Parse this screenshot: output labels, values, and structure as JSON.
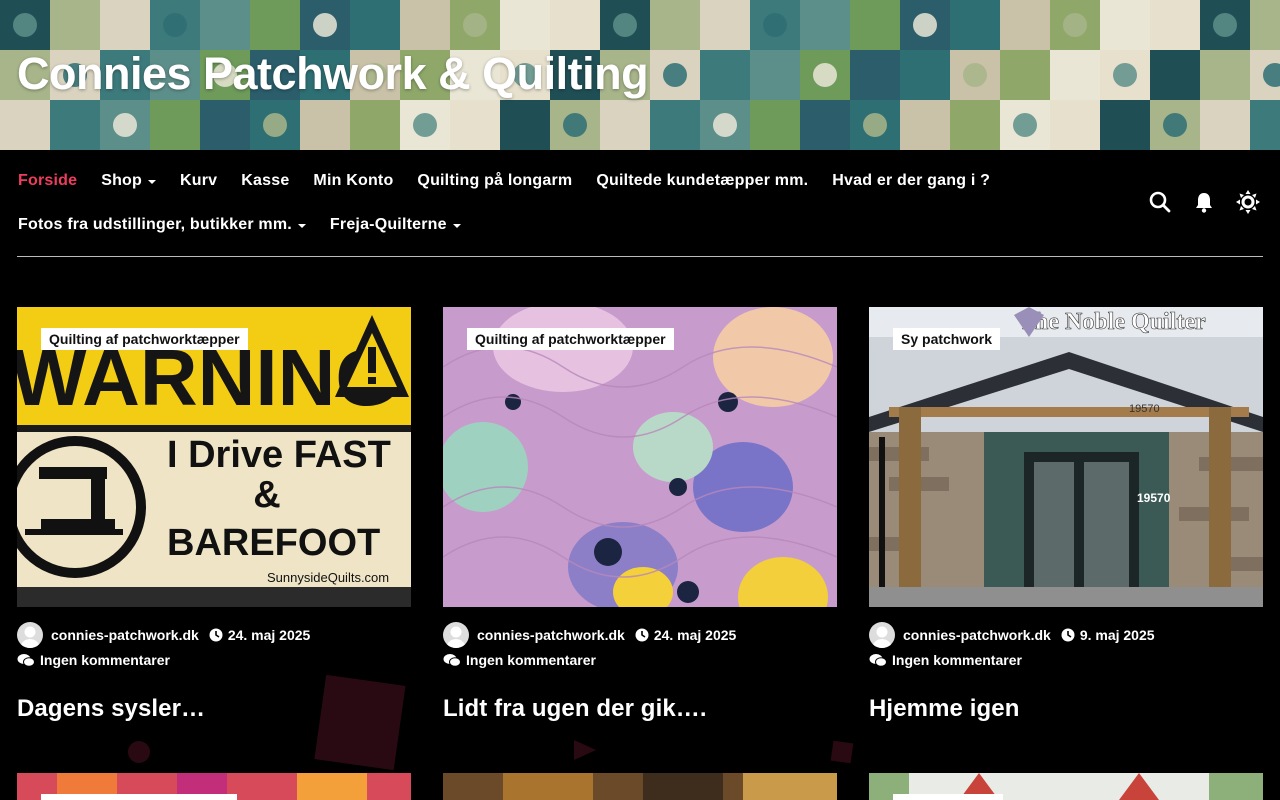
{
  "site": {
    "title": "Connies Patchwork & Quilting"
  },
  "nav": {
    "row1": [
      {
        "label": "Forside",
        "active": true,
        "dropdown": false
      },
      {
        "label": "Shop",
        "active": false,
        "dropdown": true
      },
      {
        "label": "Kurv",
        "active": false,
        "dropdown": false
      },
      {
        "label": "Kasse",
        "active": false,
        "dropdown": false
      },
      {
        "label": "Min Konto",
        "active": false,
        "dropdown": false
      },
      {
        "label": "Quilting på longarm",
        "active": false,
        "dropdown": false
      },
      {
        "label": "Quiltede kundetæpper mm.",
        "active": false,
        "dropdown": false
      },
      {
        "label": "Hvad er der gang i ?",
        "active": false,
        "dropdown": false
      }
    ],
    "row2": [
      {
        "label": "Fotos fra udstillinger, butikker mm.",
        "active": false,
        "dropdown": true
      },
      {
        "label": "Freja-Quilterne",
        "active": false,
        "dropdown": true
      }
    ],
    "icons": [
      "search-icon",
      "bell-icon",
      "sun-icon"
    ]
  },
  "colors": {
    "accent": "#ee3d5c",
    "background": "#000000"
  },
  "posts": [
    {
      "category": "Quilting af patchworktæpper",
      "author": "connies-patchwork.dk",
      "date": "24. maj 2025",
      "comments": "Ingen kommentarer",
      "title": "Dagens sysler…",
      "image": {
        "alt": "WARNING I Drive FAST & BAREFOOT",
        "sign_word": "WARNING",
        "sign_line1": "I Drive FAST",
        "sign_line2": "&",
        "sign_line3": "BAREFOOT",
        "sign_url": "SunnysideQuilts.com"
      }
    },
    {
      "category": "Quilting af patchworktæpper",
      "author": "connies-patchwork.dk",
      "date": "24. maj 2025",
      "comments": "Ingen kommentarer",
      "title": "Lidt fra ugen der gik….",
      "image": {
        "alt": "quilted fabric"
      }
    },
    {
      "category": "Sy patchwork",
      "author": "connies-patchwork.dk",
      "date": "9. maj 2025",
      "comments": "Ingen kommentarer",
      "title": "Hjemme igen",
      "image": {
        "alt": "The Noble Quilter storefront",
        "sign": "The Noble Quilter",
        "number": "19570"
      }
    }
  ]
}
